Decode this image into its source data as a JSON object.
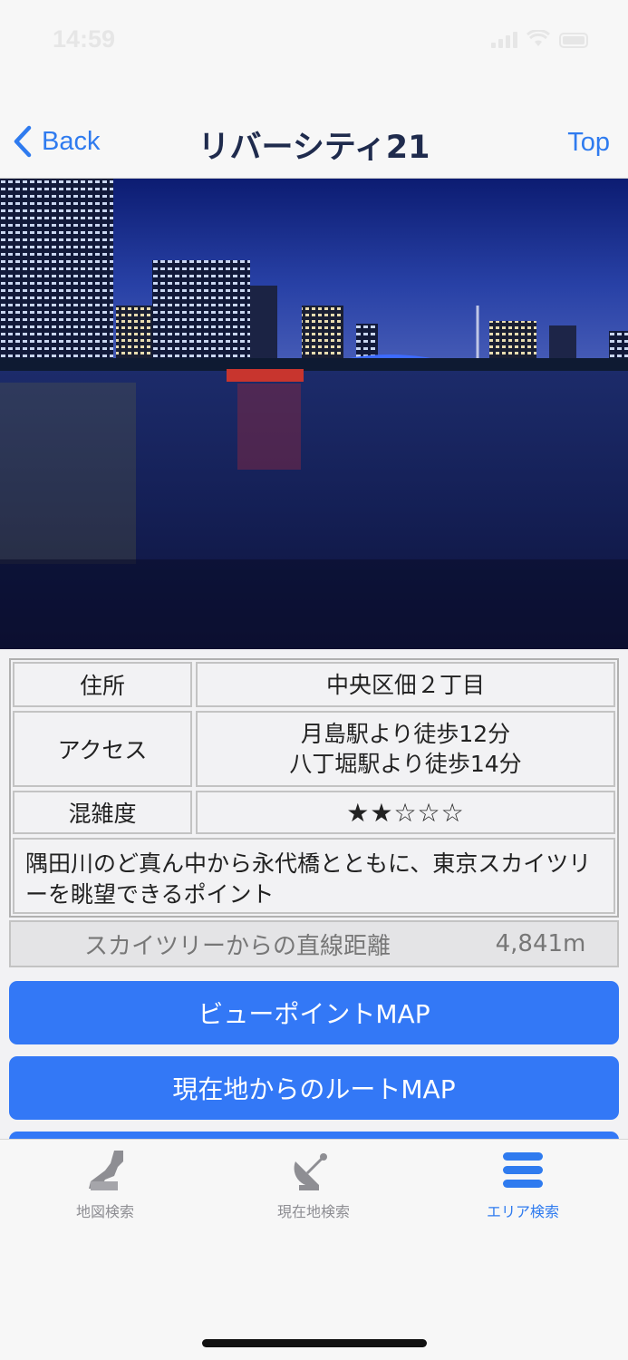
{
  "status_bar": {
    "time": "14:59"
  },
  "nav": {
    "back_label": "Back",
    "title": "リバーシティ21",
    "top_label": "Top"
  },
  "photo": {
    "description_icon": "night-river-photo"
  },
  "info": {
    "address_label": "住所",
    "address_value": "中央区佃２丁目",
    "access_label": "アクセス",
    "access_lines": [
      "月島駅より徒歩12分",
      "八丁堀駅より徒歩14分"
    ],
    "crowd_label": "混雑度",
    "crowd_stars": "★★☆☆☆",
    "crowd_rating": 2,
    "crowd_max": 5,
    "description": "隅田川のど真ん中から永代橋とともに、東京スカイツリーを眺望できるポイント"
  },
  "distance": {
    "label": "スカイツリーからの直線距離",
    "value": "4,841m"
  },
  "buttons": {
    "viewpoint_map": "ビューポイントMAP",
    "route_map": "現在地からのルートMAP"
  },
  "tabs": [
    {
      "label": "地図検索",
      "icon": "japan-map-icon",
      "selected": false
    },
    {
      "label": "現在地検索",
      "icon": "satellite-dish-icon",
      "selected": false
    },
    {
      "label": "エリア検索",
      "icon": "list-stack-icon",
      "selected": true
    }
  ],
  "colors": {
    "accent": "#2f7bef",
    "button": "#3378f6",
    "title": "#1f2b4d"
  }
}
